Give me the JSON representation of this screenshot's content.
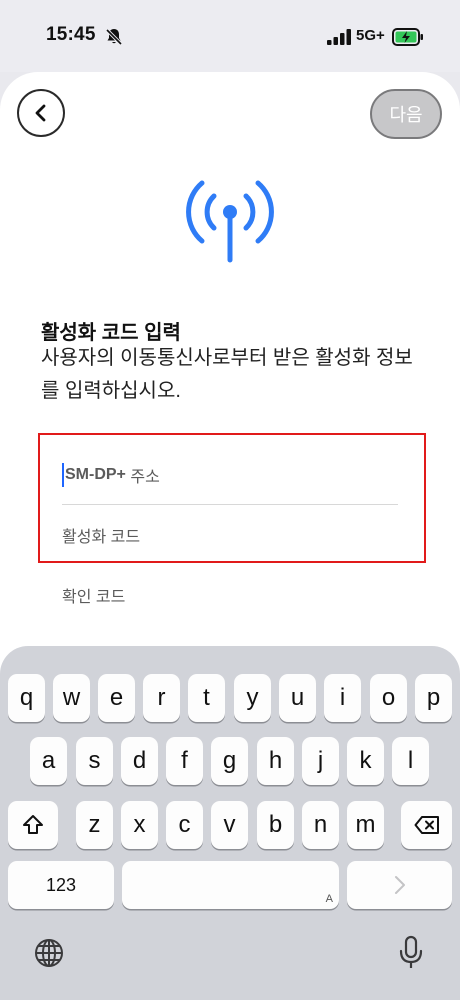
{
  "status_bar": {
    "time": "15:45",
    "network": "5G+",
    "icons": [
      "bell-slash-icon",
      "signal-bars-icon",
      "battery-charging-icon"
    ]
  },
  "header": {
    "back_icon": "chevron-left-icon",
    "next_label": "다음"
  },
  "main": {
    "icon": "antenna-icon",
    "title": "활성화 코드 입력",
    "subtitle": "사용자의 이동통신사로부터 받은 활성화 정보를 입력하십시오.",
    "fields": {
      "smdp_placeholder_bold": "SM-DP+",
      "smdp_placeholder_rest": " 주소",
      "activation_placeholder": "활성화 코드",
      "confirm_placeholder": "확인 코드"
    }
  },
  "colors": {
    "accent_blue": "#1e66ff",
    "highlight_red": "#e11a1a",
    "next_button_bg": "#c7c7c9"
  },
  "keyboard": {
    "row1": [
      "q",
      "w",
      "e",
      "r",
      "t",
      "y",
      "u",
      "i",
      "o",
      "p"
    ],
    "row2": [
      "a",
      "s",
      "d",
      "f",
      "g",
      "h",
      "j",
      "k",
      "l"
    ],
    "row3": [
      "z",
      "x",
      "c",
      "v",
      "b",
      "n",
      "m"
    ],
    "numbers_label": "123",
    "space_hint": "A",
    "return_icon": "chevron-right-icon",
    "shift_icon": "shift-icon",
    "delete_icon": "delete-icon",
    "globe_icon": "globe-icon",
    "mic_icon": "microphone-icon"
  }
}
